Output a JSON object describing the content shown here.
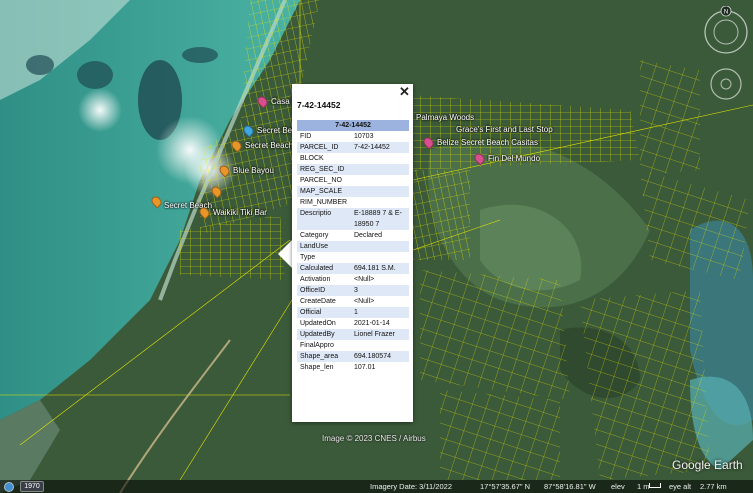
{
  "map": {
    "markers": [
      {
        "name": "Secret Beach",
        "color": "orange",
        "label_left": true
      },
      {
        "name": "Secret Beach",
        "color": "blue"
      },
      {
        "name": "Secret Beach",
        "color": "orange"
      },
      {
        "name": "Blue Bayou",
        "color": "orange"
      },
      {
        "name": "Secret Beach",
        "color": "orange"
      },
      {
        "name": "Waikiki Tiki Bar",
        "color": "orange"
      },
      {
        "name": "Palmaya Woods",
        "color": "pink"
      },
      {
        "name": "Grace's First and Last Stop",
        "color": "pink"
      },
      {
        "name": "Belize Secret Beach Casitas",
        "color": "pink"
      },
      {
        "name": "Fin Del Mundo",
        "color": "pink"
      },
      {
        "name": "Casa Tranquila",
        "color": "pink"
      }
    ],
    "attribution": "Image © 2023 CNES / Airbus",
    "brand": "Google Earth"
  },
  "popup": {
    "title": "7-42-14452",
    "close_glyph": "✕",
    "header": "7-42-14452",
    "rows": [
      {
        "key": "FID",
        "value": "10703"
      },
      {
        "key": "PARCEL_ID",
        "value": "7-42-14452"
      },
      {
        "key": "BLOCK",
        "value": ""
      },
      {
        "key": "REG_SEC_ID",
        "value": ""
      },
      {
        "key": "PARCEL_NO",
        "value": ""
      },
      {
        "key": "MAP_SCALE",
        "value": ""
      },
      {
        "key": "RIM_NUMBER",
        "value": ""
      },
      {
        "key": "Descriptio",
        "value": "E-18889 7 & E-18950 7"
      },
      {
        "key": "Category",
        "value": "Declared"
      },
      {
        "key": "LandUse",
        "value": ""
      },
      {
        "key": "Type",
        "value": ""
      },
      {
        "key": "Calculated",
        "value": "694.181 S.M."
      },
      {
        "key": "Activation",
        "value": "<Null>"
      },
      {
        "key": "OfficeID",
        "value": "3"
      },
      {
        "key": "CreateDate",
        "value": "<Null>"
      },
      {
        "key": "Official",
        "value": "1"
      },
      {
        "key": "UpdatedOn",
        "value": "2021-01-14"
      },
      {
        "key": "UpdatedBy",
        "value": "Lionel Frazer"
      },
      {
        "key": "FinalAppro",
        "value": ""
      },
      {
        "key": "Shape_area",
        "value": "694.180574"
      },
      {
        "key": "Shape_len",
        "value": "107.01"
      }
    ]
  },
  "statusbar": {
    "year": "1970",
    "imagery_date": "Imagery Date: 3/11/2022",
    "latitude": "17°57'35.67\" N",
    "longitude": "87°58'16.81\" W",
    "elev_label": "elev",
    "elev_value": "1 m",
    "eye_alt": "eye alt",
    "eye_alt_value": "2.77 km"
  },
  "colors": {
    "parcel_lines": "#e6e600",
    "sea": "#3a9e92",
    "land": "#3d5e3a",
    "popup_header": "#9bb3de"
  },
  "icons": {
    "compass": "compass-icon",
    "globe": "globe-icon"
  }
}
